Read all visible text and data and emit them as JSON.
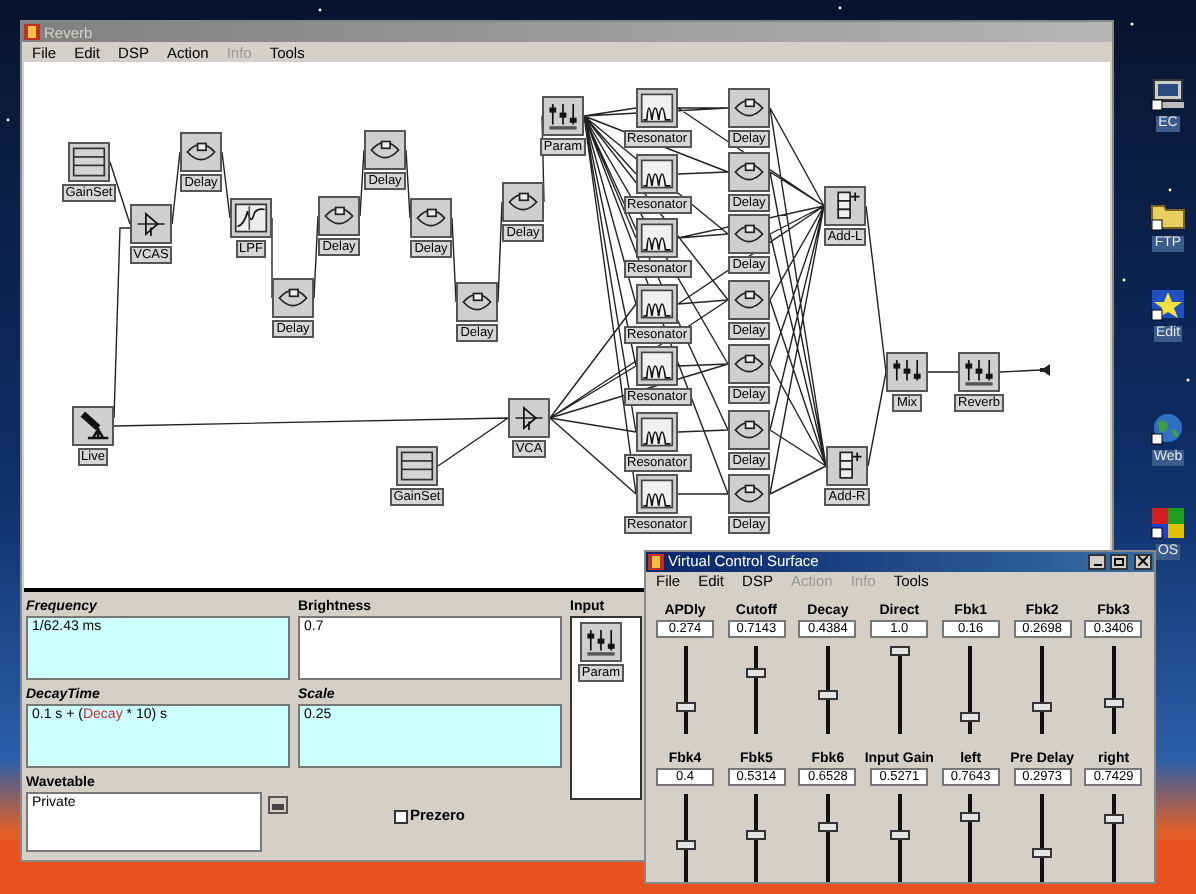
{
  "main_window": {
    "title": "Reverb",
    "active": false,
    "menu": [
      {
        "label": "File",
        "disabled": false
      },
      {
        "label": "Edit",
        "disabled": false
      },
      {
        "label": "DSP",
        "disabled": false
      },
      {
        "label": "Action",
        "disabled": false
      },
      {
        "label": "Info",
        "disabled": true
      },
      {
        "label": "Tools",
        "disabled": false
      }
    ],
    "canvas": {
      "modules": [
        {
          "label": "GainSet",
          "kind": "gainset"
        },
        {
          "label": "VCAS",
          "kind": "vca"
        },
        {
          "label": "Delay",
          "kind": "delay"
        },
        {
          "label": "LPF",
          "kind": "lpf"
        },
        {
          "label": "Delay",
          "kind": "delay"
        },
        {
          "label": "Delay",
          "kind": "delay"
        },
        {
          "label": "Delay",
          "kind": "delay"
        },
        {
          "label": "Delay",
          "kind": "delay"
        },
        {
          "label": "Delay",
          "kind": "delay"
        },
        {
          "label": "Delay",
          "kind": "delay"
        },
        {
          "label": "Param",
          "kind": "param"
        },
        {
          "label": "Live",
          "kind": "live"
        },
        {
          "label": "GainSet",
          "kind": "gainset"
        },
        {
          "label": "VCA",
          "kind": "vca"
        },
        {
          "label": "Resonator",
          "kind": "resonator"
        },
        {
          "label": "Resonator",
          "kind": "resonator"
        },
        {
          "label": "Resonator",
          "kind": "resonator"
        },
        {
          "label": "Resonator",
          "kind": "resonator"
        },
        {
          "label": "Resonator",
          "kind": "resonator"
        },
        {
          "label": "Resonator",
          "kind": "resonator"
        },
        {
          "label": "Resonator",
          "kind": "resonator"
        },
        {
          "label": "Delay",
          "kind": "delay"
        },
        {
          "label": "Delay",
          "kind": "delay"
        },
        {
          "label": "Delay",
          "kind": "delay"
        },
        {
          "label": "Delay",
          "kind": "delay"
        },
        {
          "label": "Delay",
          "kind": "delay"
        },
        {
          "label": "Delay",
          "kind": "delay"
        },
        {
          "label": "Delay",
          "kind": "delay"
        },
        {
          "label": "Add-L",
          "kind": "add"
        },
        {
          "label": "Add-R",
          "kind": "add"
        },
        {
          "label": "Mix",
          "kind": "mix"
        },
        {
          "label": "Reverb",
          "kind": "param"
        }
      ]
    },
    "inspector": {
      "fields": [
        {
          "label": "Frequency",
          "highlighted": true,
          "value": [
            {
              "text": "1/62.43 ms",
              "kind": "plain"
            }
          ]
        },
        {
          "label": "Brightness",
          "highlighted": false,
          "value": [
            {
              "text": "0.7",
              "kind": "plain"
            }
          ]
        },
        {
          "label": "DecayTime",
          "highlighted": true,
          "value": [
            {
              "text": "0.1 s + (",
              "kind": "plain"
            },
            {
              "text": "Decay",
              "kind": "variable"
            },
            {
              "text": " * 10) s",
              "kind": "plain"
            }
          ]
        },
        {
          "label": "Scale",
          "highlighted": true,
          "value": [
            {
              "text": "0.25",
              "kind": "plain"
            }
          ]
        }
      ],
      "wavetable": {
        "label": "Wavetable",
        "value": "Private"
      },
      "prezero": {
        "label": "Prezero",
        "checked": false
      },
      "input": {
        "label": "Input",
        "module": {
          "label": "Param",
          "kind": "param"
        }
      }
    }
  },
  "control_surface": {
    "title": "Virtual Control Surface",
    "active": true,
    "menu": [
      {
        "label": "File",
        "disabled": false
      },
      {
        "label": "Edit",
        "disabled": false
      },
      {
        "label": "DSP",
        "disabled": false
      },
      {
        "label": "Action",
        "disabled": true
      },
      {
        "label": "Info",
        "disabled": true
      },
      {
        "label": "Tools",
        "disabled": false
      }
    ],
    "sliders": [
      {
        "label": "APDly",
        "value": "0.274",
        "level": 0.274
      },
      {
        "label": "Cutoff",
        "value": "0.7143",
        "level": 0.7143
      },
      {
        "label": "Decay",
        "value": "0.4384",
        "level": 0.4384
      },
      {
        "label": "Direct",
        "value": "1.0",
        "level": 1.0
      },
      {
        "label": "Fbk1",
        "value": "0.16",
        "level": 0.16
      },
      {
        "label": "Fbk2",
        "value": "0.2698",
        "level": 0.2698
      },
      {
        "label": "Fbk3",
        "value": "0.3406",
        "level": 0.3406
      },
      {
        "label": "Fbk4",
        "value": "0.4",
        "level": 0.4
      },
      {
        "label": "Fbk5",
        "value": "0.5314",
        "level": 0.5314
      },
      {
        "label": "Fbk6",
        "value": "0.6528",
        "level": 0.6528
      },
      {
        "label": "Input Gain",
        "value": "0.5271",
        "level": 0.5271
      },
      {
        "label": "left",
        "value": "0.7643",
        "level": 0.7643
      },
      {
        "label": "Pre Delay",
        "value": "0.2973",
        "level": 0.2973
      },
      {
        "label": "right",
        "value": "0.7429",
        "level": 0.7429
      }
    ]
  },
  "desktop_icons": [
    {
      "label": "EC",
      "kind": "monitor"
    },
    {
      "label": "FTP",
      "kind": "folder"
    },
    {
      "label": "Edit",
      "kind": "burst"
    },
    {
      "label": "Web",
      "kind": "globe"
    },
    {
      "label": "OS",
      "kind": "logo"
    }
  ]
}
